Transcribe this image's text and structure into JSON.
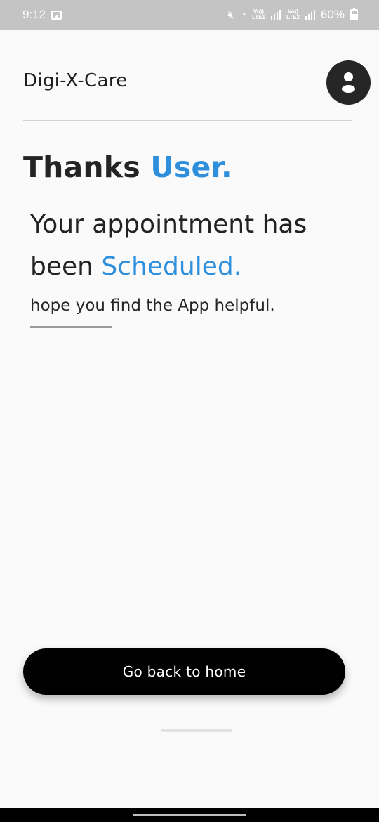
{
  "status_bar": {
    "time": "9:12",
    "volte1": "Vo))",
    "lte1": "LTE1",
    "volte2": "Vo))",
    "lte2": "LTE2",
    "battery_percent": "60%",
    "icons": [
      "image-icon",
      "mute-icon",
      "wifi-icon",
      "signal-icon",
      "battery-icon"
    ]
  },
  "header": {
    "title": "Digi-X-Care",
    "profile_icon": "user-icon"
  },
  "content": {
    "thanks_prefix": "Thanks",
    "user_name": "User.",
    "message_prefix": "Your appointment has been",
    "message_status": "Scheduled.",
    "hint": "hope you find the App helpful."
  },
  "actions": {
    "home_button_label": "Go back to home"
  },
  "colors": {
    "accent": "#2e8fdd",
    "button_bg": "#000000",
    "background": "#fafafa"
  }
}
